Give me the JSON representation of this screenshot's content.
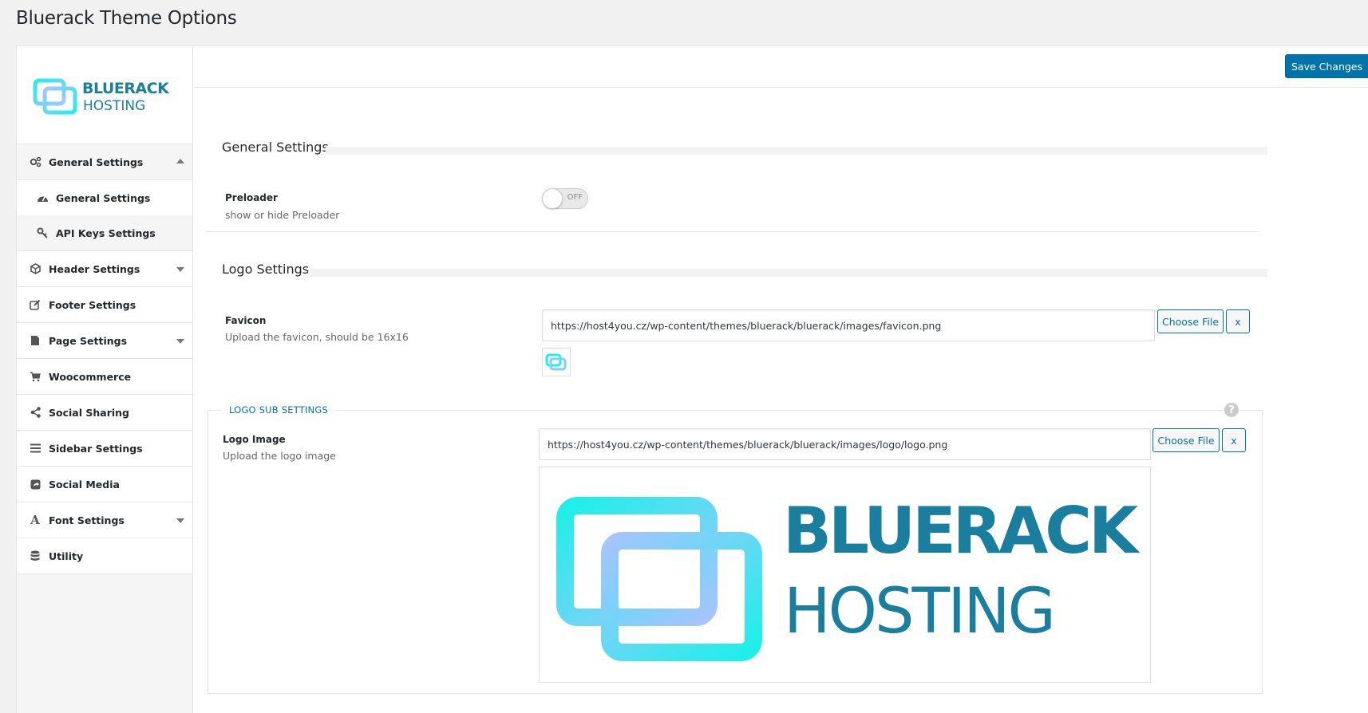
{
  "page": {
    "title": "Bluerack Theme Options"
  },
  "brand": {
    "line1": "BLUERACK",
    "line2": "HOSTING",
    "color_dark": "#1a7e9e",
    "color_cyan": "#1cf0e8",
    "color_lilac": "#a6c4ff"
  },
  "sidebar": {
    "items": [
      {
        "label": "General Settings",
        "icon": "gears-icon",
        "state": "expanded"
      },
      {
        "label": "Header Settings",
        "icon": "cube-icon",
        "state": "collapsed"
      },
      {
        "label": "Footer Settings",
        "icon": "edit-icon",
        "state": "none"
      },
      {
        "label": "Page Settings",
        "icon": "file-icon",
        "state": "collapsed"
      },
      {
        "label": "Woocommerce",
        "icon": "cart-icon",
        "state": "none"
      },
      {
        "label": "Social Sharing",
        "icon": "share-icon",
        "state": "none"
      },
      {
        "label": "Sidebar Settings",
        "icon": "list-icon",
        "state": "none"
      },
      {
        "label": "Social Media",
        "icon": "share-square-icon",
        "state": "none"
      },
      {
        "label": "Font Settings",
        "icon": "font-icon",
        "state": "collapsed"
      },
      {
        "label": "Utility",
        "icon": "database-icon",
        "state": "none"
      }
    ],
    "subitems": [
      {
        "label": "General Settings",
        "icon": "dashboard-icon",
        "active": true
      },
      {
        "label": "API Keys Settings",
        "icon": "key-icon",
        "active": false
      }
    ]
  },
  "toolbar": {
    "save_label": "Save Changes"
  },
  "sections": {
    "general": {
      "title": "General Settings",
      "preloader": {
        "label": "Preloader",
        "desc": "show or hide Preloader",
        "toggle_label": "OFF",
        "value": false
      }
    },
    "logo": {
      "title": "Logo Settings",
      "favicon": {
        "label": "Favicon",
        "desc": "Upload the favicon, should be 16x16",
        "value": "https://host4you.cz/wp-content/themes/bluerack/bluerack/images/favicon.png",
        "choose_label": "Choose File",
        "remove_label": "x"
      },
      "sub": {
        "legend": "LOGO SUB SETTINGS",
        "help": "?",
        "logo_image": {
          "label": "Logo Image",
          "desc": "Upload the logo image",
          "value": "https://host4you.cz/wp-content/themes/bluerack/bluerack/images/logo/logo.png",
          "choose_label": "Choose File",
          "remove_label": "x"
        }
      }
    }
  }
}
